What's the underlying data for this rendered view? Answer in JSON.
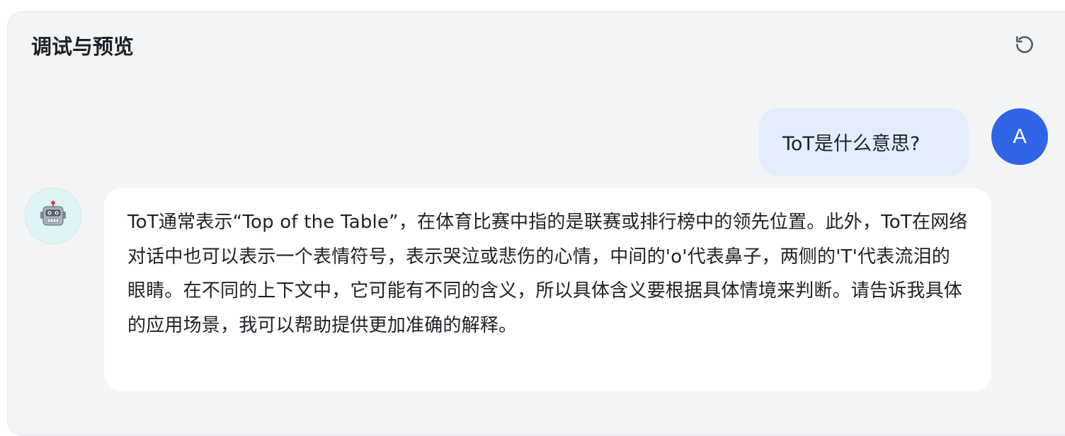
{
  "header": {
    "title": "调试与预览",
    "refresh_icon": "refresh-icon"
  },
  "chat": {
    "user_message": "ToT是什么意思?",
    "user_avatar_letter": "A",
    "bot_avatar_icon": "robot-icon",
    "bot_message": "ToT通常表示“Top of the Table”，在体育比赛中指的是联赛或排行榜中的领先位置。此外，ToT在网络对话中也可以表示一个表情符号，表示哭泣或悲伤的心情，中间的'o'代表鼻子，两侧的'T'代表流泪的眼睛。在不同的上下文中，它可能有不同的含义，所以具体含义要根据具体情境来判断。请告诉我具体的应用场景，我可以帮助提供更加准确的解释。"
  },
  "colors": {
    "user_avatar_bg": "#2f64e9",
    "user_bubble_bg": "#e1edfc",
    "bot_avatar_bg": "#dff4f6",
    "panel_bg": "#f3f4f6"
  }
}
